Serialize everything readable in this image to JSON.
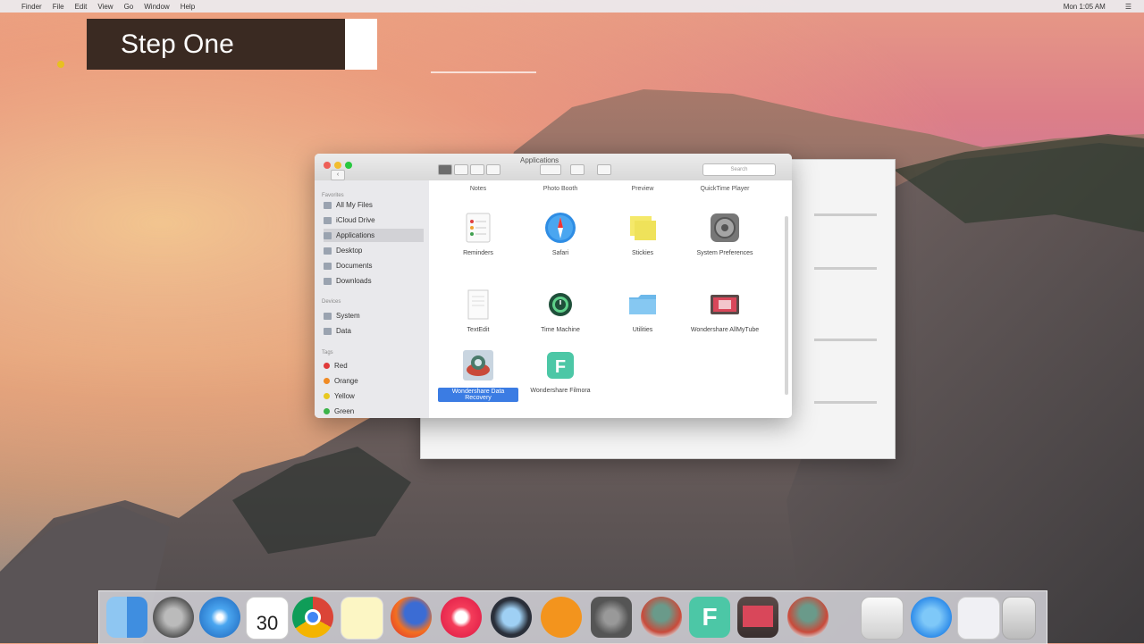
{
  "menubar": {
    "apple": "",
    "items": [
      "Finder",
      "File",
      "Edit",
      "View",
      "Go",
      "Window",
      "Help"
    ],
    "right": [
      "Mon 1:05 AM",
      "☰"
    ]
  },
  "overlay": {
    "step_title": "Step One"
  },
  "finder": {
    "title": "Applications",
    "search_placeholder": "Search",
    "sidebar": {
      "favorites_header": "Favorites",
      "favorites": [
        "All My Files",
        "iCloud Drive",
        "Applications",
        "Desktop",
        "Documents",
        "Downloads"
      ],
      "devices_header": "Devices",
      "devices": [
        "System",
        "Data"
      ],
      "tags_header": "Tags",
      "tags": [
        {
          "label": "Red",
          "color": "#e03a3a"
        },
        {
          "label": "Orange",
          "color": "#f08a24"
        },
        {
          "label": "Yellow",
          "color": "#e8c820"
        },
        {
          "label": "Green",
          "color": "#3cb44a"
        }
      ]
    },
    "column_headers": [
      "Notes",
      "Photo Booth",
      "Preview",
      "QuickTime Player"
    ],
    "apps": [
      {
        "label": "Reminders",
        "icon": "reminders-icon"
      },
      {
        "label": "Safari",
        "icon": "safari-icon"
      },
      {
        "label": "Stickies",
        "icon": "stickies-icon"
      },
      {
        "label": "System Preferences",
        "icon": "system-preferences-icon"
      },
      {
        "label": "TextEdit",
        "icon": "textedit-icon"
      },
      {
        "label": "Time Machine",
        "icon": "time-machine-icon"
      },
      {
        "label": "Utilities",
        "icon": "folder-icon"
      },
      {
        "label": "Wondershare AllMyTube",
        "icon": "allmytube-icon"
      },
      {
        "label": "Wondershare Data Recovery",
        "icon": "data-recovery-icon",
        "selected": true
      },
      {
        "label": "Wondershare Filmora",
        "icon": "filmora-icon"
      }
    ]
  },
  "dock": {
    "items": [
      "finder-icon",
      "launchpad-icon",
      "safari-icon",
      "calendar-icon",
      "chrome-icon",
      "notes-icon",
      "firefox-icon",
      "itunes-icon",
      "quicktime-icon",
      "ibooks-icon",
      "system-preferences-icon",
      "data-recovery-icon",
      "filmora-icon",
      "allmytube-icon",
      "data-recovery-icon",
      "preview-icon",
      "app-store-icon",
      "downloads-stack-icon",
      "trash-icon"
    ],
    "calendar_day": "30"
  }
}
